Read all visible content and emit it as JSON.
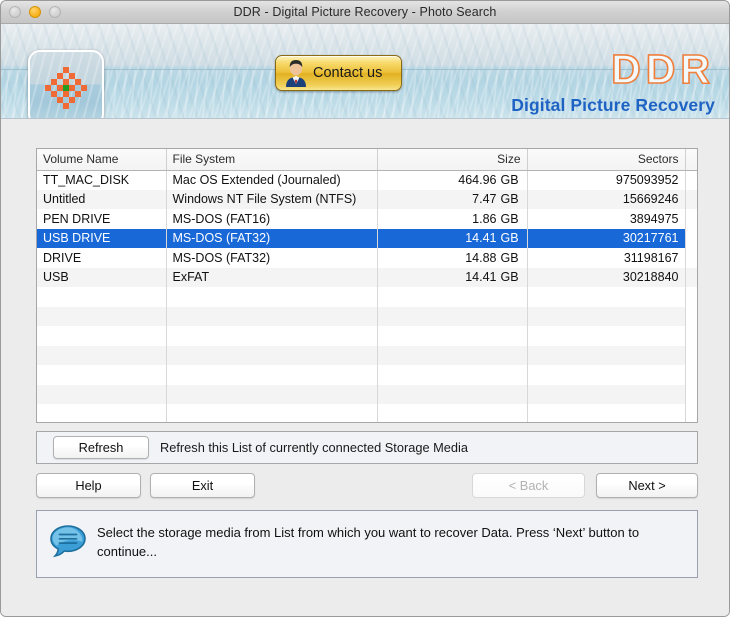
{
  "window": {
    "title": "DDR - Digital Picture Recovery - Photo Search",
    "traffic_lights": {
      "close": "close-button",
      "minimize": "minimize-button",
      "zoom": "zoom-button"
    }
  },
  "banner": {
    "logo_icon": "checkered-flower-icon",
    "contact_button": {
      "label": "Contact us",
      "icon": "person-avatar-icon"
    },
    "brand": {
      "title": "DDR",
      "subtitle": "Digital Picture Recovery",
      "title_color": "#f07f3c",
      "subtitle_color": "#1e63c4"
    }
  },
  "table": {
    "columns": [
      {
        "label": "Volume Name",
        "align": "left"
      },
      {
        "label": "File System",
        "align": "left"
      },
      {
        "label": "Size",
        "align": "right"
      },
      {
        "label": "Sectors",
        "align": "right"
      },
      {
        "label": "",
        "align": "left"
      }
    ],
    "selected_index": 3,
    "selection_color": "#1868d8",
    "rows": [
      {
        "volume": "TT_MAC_DISK",
        "filesystem": "Mac OS Extended (Journaled)",
        "size": "464.96",
        "unit": "GB",
        "sectors": "975093952"
      },
      {
        "volume": "Untitled",
        "filesystem": "Windows NT File System (NTFS)",
        "size": "7.47",
        "unit": "GB",
        "sectors": "15669246"
      },
      {
        "volume": "PEN DRIVE",
        "filesystem": "MS-DOS (FAT16)",
        "size": "1.86",
        "unit": "GB",
        "sectors": "3894975"
      },
      {
        "volume": "USB DRIVE",
        "filesystem": "MS-DOS (FAT32)",
        "size": "14.41",
        "unit": "GB",
        "sectors": "30217761"
      },
      {
        "volume": "DRIVE",
        "filesystem": "MS-DOS (FAT32)",
        "size": "14.88",
        "unit": "GB",
        "sectors": "31198167"
      },
      {
        "volume": "USB",
        "filesystem": "ExFAT",
        "size": "14.41",
        "unit": "GB",
        "sectors": "30218840"
      }
    ],
    "empty_row_count": 7
  },
  "refresh_bar": {
    "button_label": "Refresh",
    "hint": "Refresh this List of currently connected Storage Media"
  },
  "nav": {
    "help_label": "Help",
    "exit_label": "Exit",
    "back_label": "< Back",
    "next_label": "Next >",
    "back_enabled": false
  },
  "status": {
    "icon": "speech-bubble-icon",
    "message": "Select the storage media from List from which you want to recover Data. Press ‘Next’ button to continue..."
  }
}
